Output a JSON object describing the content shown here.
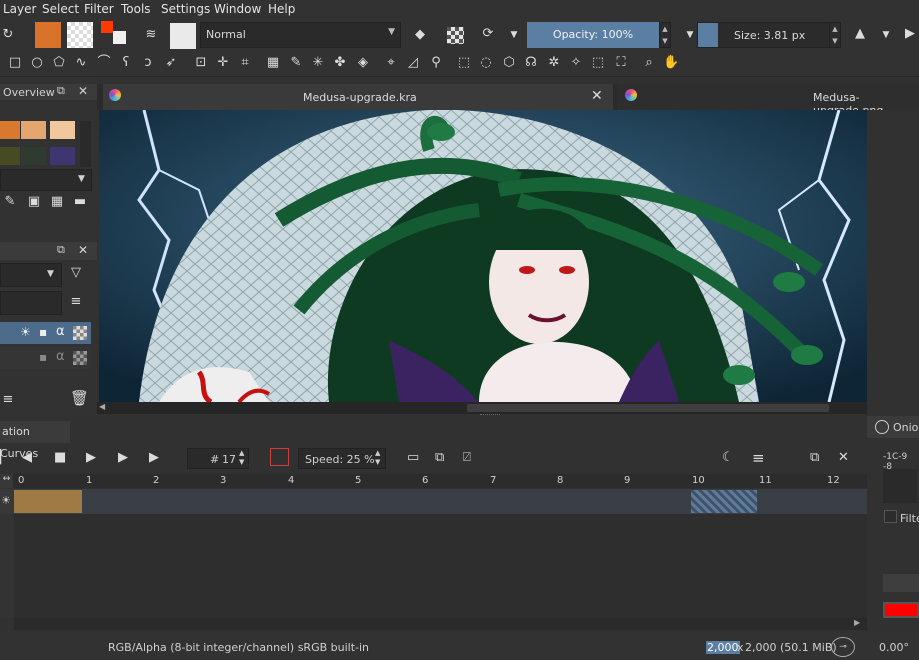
{
  "menu": [
    "Layer",
    "Select",
    "Filter",
    "Tools",
    "Settings",
    "Window",
    "Help"
  ],
  "toolbar": {
    "blend_mode": "Normal",
    "opacity_label": "Opacity: 100%",
    "size_label": "Size: 3.81 px"
  },
  "left_dock": {
    "overview_title": "Overview",
    "swatches": [
      "#d9792f",
      "#e2a66e",
      "#f1c89e",
      "#484a22",
      "#2f3b30",
      "#3e3670"
    ]
  },
  "tabs": [
    {
      "label": "Medusa-upgrade.kra",
      "active": true
    },
    {
      "label": "Medusa-upgrade.png",
      "active": false
    }
  ],
  "animation": {
    "title": "ation Curves",
    "frame_number": "17",
    "frame_prefix": "#",
    "speed_label": "Speed: 25 %",
    "ruler_numbers": [
      "0",
      "1",
      "2",
      "3",
      "4",
      "5",
      "6",
      "7",
      "8",
      "9",
      "10",
      "11",
      "12"
    ]
  },
  "onion": {
    "title": "Onio",
    "numbers": "-1C-9 -8",
    "filter_label": "Filte"
  },
  "status": {
    "color_profile": "RGB/Alpha (8-bit integer/channel)  sRGB built-in",
    "dimensions_a": "2,000",
    "dimensions_x": "x",
    "dimensions_b": "2,000 (50.1 MiB)",
    "rotation": "0.00°"
  },
  "colors": {
    "accent": "#5b7fa2",
    "keyframe": "#a07a45",
    "onion_red": "#ff0000"
  }
}
